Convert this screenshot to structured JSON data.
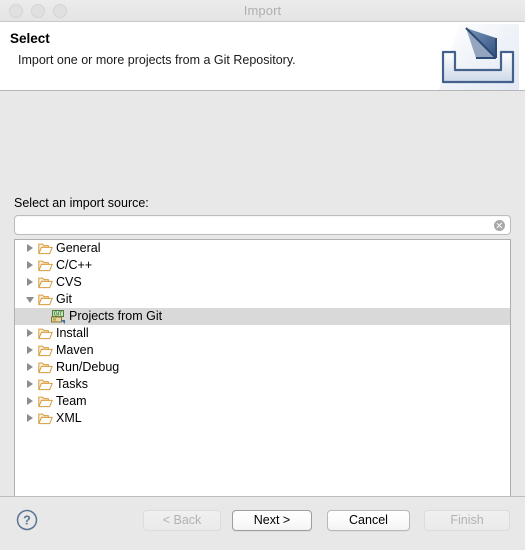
{
  "window": {
    "title": "Import",
    "traffic_lights": [
      "close-button",
      "minimize-button",
      "zoom-button"
    ]
  },
  "header": {
    "title": "Select",
    "description": "Import one or more projects from a Git Repository.",
    "icon": "import-wizard-icon"
  },
  "main": {
    "source_label": "Select an import source:",
    "filter": {
      "value": "",
      "placeholder": "",
      "clear_icon": "clear-circle-icon"
    },
    "tree": [
      {
        "label": "General",
        "icon": "folder-icon",
        "state": "collapsed",
        "level": 0,
        "selected": false
      },
      {
        "label": "C/C++",
        "icon": "folder-icon",
        "state": "collapsed",
        "level": 0,
        "selected": false
      },
      {
        "label": "CVS",
        "icon": "folder-icon",
        "state": "collapsed",
        "level": 0,
        "selected": false
      },
      {
        "label": "Git",
        "icon": "folder-icon",
        "state": "expanded",
        "level": 0,
        "selected": false
      },
      {
        "label": "Projects from Git",
        "icon": "git-icon",
        "state": "leaf",
        "level": 1,
        "selected": true
      },
      {
        "label": "Install",
        "icon": "folder-icon",
        "state": "collapsed",
        "level": 0,
        "selected": false
      },
      {
        "label": "Maven",
        "icon": "folder-icon",
        "state": "collapsed",
        "level": 0,
        "selected": false
      },
      {
        "label": "Run/Debug",
        "icon": "folder-icon",
        "state": "collapsed",
        "level": 0,
        "selected": false
      },
      {
        "label": "Tasks",
        "icon": "folder-icon",
        "state": "collapsed",
        "level": 0,
        "selected": false
      },
      {
        "label": "Team",
        "icon": "folder-icon",
        "state": "collapsed",
        "level": 0,
        "selected": false
      },
      {
        "label": "XML",
        "icon": "folder-icon",
        "state": "collapsed",
        "level": 0,
        "selected": false
      }
    ]
  },
  "footer": {
    "help_icon": "help-question-icon",
    "buttons": [
      {
        "id": "back",
        "label": "< Back",
        "enabled": false,
        "default": false
      },
      {
        "id": "next",
        "label": "Next >",
        "enabled": true,
        "default": true
      },
      {
        "id": "cancel",
        "label": "Cancel",
        "enabled": true,
        "default": false
      },
      {
        "id": "finish",
        "label": "Finish",
        "enabled": false,
        "default": false
      }
    ]
  },
  "colors": {
    "window_background": "#e8e8e8",
    "header_background": "#ffffff",
    "selection": "#d9d9d9",
    "folder_outline": "#d99b39",
    "accent_blue": "#3b5f8f",
    "title_text": "#b0b0b0"
  }
}
